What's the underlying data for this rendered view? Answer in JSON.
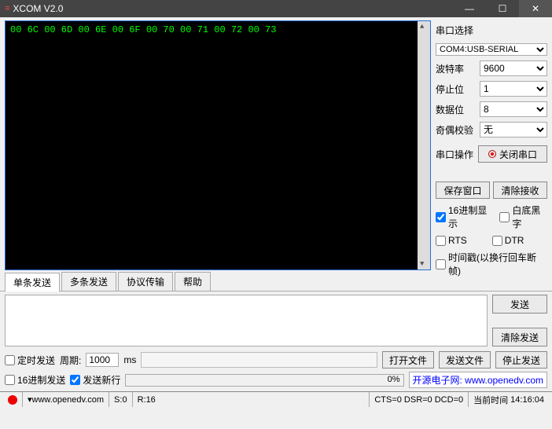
{
  "window": {
    "title": "XCOM V2.0"
  },
  "terminal": {
    "output": "00 6C 00 6D 00 6E 00 6F 00 70 00 71 00 72 00 73"
  },
  "side": {
    "port_select_label": "串口选择",
    "port_value": "COM4:USB-SERIAL",
    "baud_label": "波特率",
    "baud_value": "9600",
    "stop_label": "停止位",
    "stop_value": "1",
    "data_label": "数据位",
    "data_value": "8",
    "parity_label": "奇偶校验",
    "parity_value": "无",
    "portop_label": "串口操作",
    "portop_btn": "关闭串口",
    "save_window": "保存窗口",
    "clear_recv": "清除接收",
    "hex_display": "16进制显示",
    "white_bg": "白底黑字",
    "rts": "RTS",
    "dtr": "DTR",
    "timestamp": "时间戳(以换行回车断帧)"
  },
  "tabs": {
    "single": "单条发送",
    "multi": "多条发送",
    "proto": "协议传输",
    "help": "帮助"
  },
  "send": {
    "send_btn": "发送",
    "clear_btn": "清除发送"
  },
  "opts": {
    "timed_send": "定时发送",
    "period_label": "周期:",
    "period_value": "1000",
    "period_unit": "ms",
    "open_file": "打开文件",
    "send_file": "发送文件",
    "stop_send": "停止发送",
    "hex_send": "16进制发送",
    "send_newline": "发送新行",
    "progress_pct": "0%",
    "link_text": "开源电子网:  www.openedv.com"
  },
  "status": {
    "url": "www.openedv.com",
    "s": "S:0",
    "r": "R:16",
    "cts": "CTS=0 DSR=0 DCD=0",
    "time_label": "当前时间",
    "time_value": "14:16:04"
  }
}
